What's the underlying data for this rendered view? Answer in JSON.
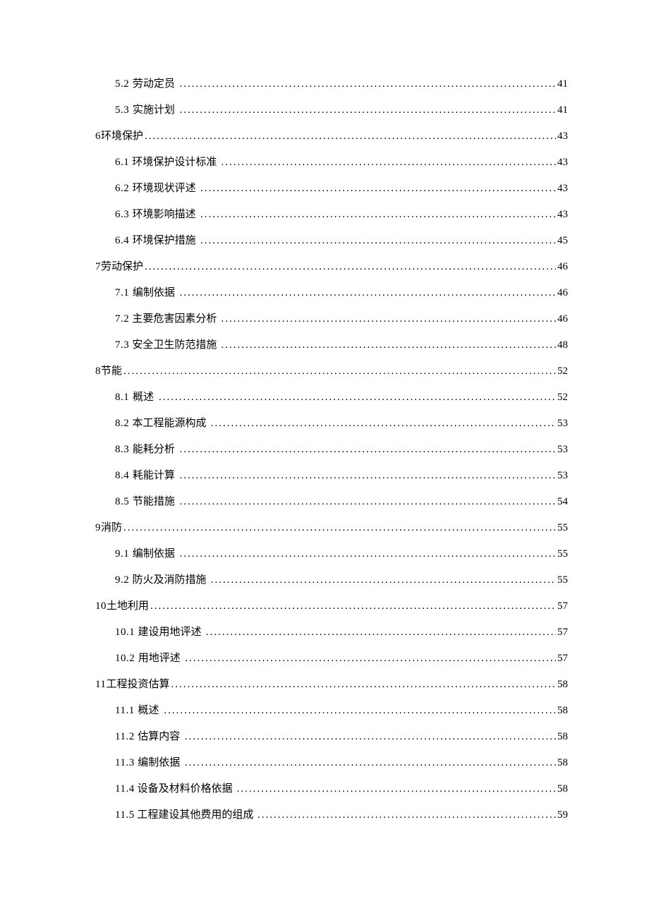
{
  "toc": [
    {
      "level": 2,
      "number": "5.2",
      "title": "劳动定员",
      "page": "41"
    },
    {
      "level": 2,
      "number": "5.3",
      "title": "实施计划",
      "page": "41"
    },
    {
      "level": 1,
      "number": "6",
      "title": "环境保护",
      "page": "43"
    },
    {
      "level": 2,
      "number": "6.1",
      "title": "环境保护设计标准",
      "page": "43"
    },
    {
      "level": 2,
      "number": "6.2",
      "title": "环境现状评述",
      "page": "43"
    },
    {
      "level": 2,
      "number": "6.3",
      "title": "环境影响描述",
      "page": "43"
    },
    {
      "level": 2,
      "number": "6.4",
      "title": "环境保护措施",
      "page": "45"
    },
    {
      "level": 1,
      "number": "7",
      "title": "劳动保护",
      "page": "46"
    },
    {
      "level": 2,
      "number": "7.1",
      "title": "编制依据",
      "page": "46"
    },
    {
      "level": 2,
      "number": "7.2",
      "title": "主要危害因素分析",
      "page": "46"
    },
    {
      "level": 2,
      "number": "7.3",
      "title": "安全卫生防范措施",
      "page": "48"
    },
    {
      "level": 1,
      "number": "8",
      "title": "节能",
      "page": "52"
    },
    {
      "level": 2,
      "number": "8.1",
      "title": "概述",
      "page": "52"
    },
    {
      "level": 2,
      "number": "8.2",
      "title": "本工程能源构成",
      "page": "53"
    },
    {
      "level": 2,
      "number": "8.3",
      "title": "能耗分析",
      "page": "53"
    },
    {
      "level": 2,
      "number": "8.4",
      "title": "耗能计算",
      "page": "53"
    },
    {
      "level": 2,
      "number": "8.5",
      "title": "节能措施",
      "page": "54"
    },
    {
      "level": 1,
      "number": "9",
      "title": "消防",
      "page": "55"
    },
    {
      "level": 2,
      "number": "9.1",
      "title": "编制依据",
      "page": "55"
    },
    {
      "level": 2,
      "number": "9.2",
      "title": "防火及消防措施",
      "page": "55"
    },
    {
      "level": 1,
      "number": "10",
      "title": "土地利用",
      "page": "57"
    },
    {
      "level": 2,
      "number": "10.1",
      "title": "建设用地评述",
      "page": "57"
    },
    {
      "level": 2,
      "number": "10.2",
      "title": "用地评述",
      "page": "57"
    },
    {
      "level": 1,
      "number": "11",
      "title": "工程投资估算",
      "page": "58"
    },
    {
      "level": 2,
      "number": "11.1",
      "title": "概述",
      "page": "58"
    },
    {
      "level": 2,
      "number": "11.2",
      "title": "估算内容",
      "page": "58"
    },
    {
      "level": 2,
      "number": "11.3",
      "title": "编制依据",
      "page": "58"
    },
    {
      "level": 2,
      "number": "11.4",
      "title": "设备及材料价格依据",
      "page": "58"
    },
    {
      "level": 2,
      "number": "11.5",
      "title": "工程建设其他费用的组成",
      "page": "59"
    }
  ]
}
